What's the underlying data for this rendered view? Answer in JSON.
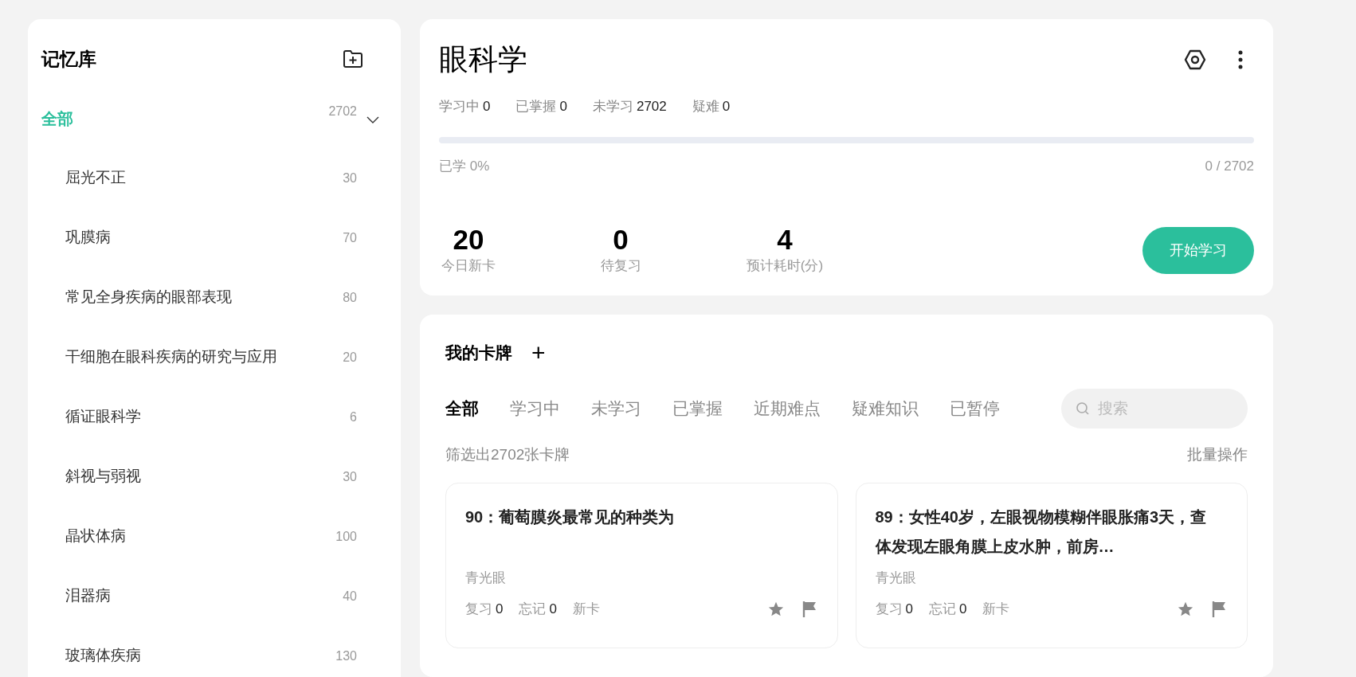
{
  "sidebar": {
    "title": "记忆库",
    "tree": {
      "label": "全部",
      "count": "2702",
      "selected": true,
      "expanded": true,
      "children": [
        {
          "label": "屈光不正",
          "count": "30",
          "selected": false
        },
        {
          "label": "巩膜病",
          "count": "70",
          "selected": false
        },
        {
          "label": "常见全身疾病的眼部表现",
          "count": "80",
          "selected": false
        },
        {
          "label": "干细胞在眼科疾病的研究与应用",
          "count": "20",
          "selected": false
        },
        {
          "label": "循证眼科学",
          "count": "6",
          "selected": false
        },
        {
          "label": "斜视与弱视",
          "count": "30",
          "selected": false
        },
        {
          "label": "晶状体病",
          "count": "100",
          "selected": false
        },
        {
          "label": "泪器病",
          "count": "40",
          "selected": false
        },
        {
          "label": "玻璃体疾病",
          "count": "130",
          "selected": false
        }
      ]
    }
  },
  "deck": {
    "title": "眼科学",
    "stats": [
      {
        "label": "学习中",
        "value": "0"
      },
      {
        "label": "已掌握",
        "value": "0"
      },
      {
        "label": "未学习",
        "value": "2702"
      },
      {
        "label": "疑难",
        "value": "0"
      }
    ],
    "progress": {
      "level": 0,
      "label": "已学 0%",
      "reading": "0 / 2702"
    },
    "metrics": [
      {
        "value": "20",
        "label": "今日新卡"
      },
      {
        "value": "0",
        "label": "待复习"
      },
      {
        "value": "4",
        "label": "预计耗时(分)"
      }
    ],
    "start_button": "开始学习"
  },
  "cards_panel": {
    "title": "我的卡牌",
    "add": "+",
    "tabs": [
      {
        "label": "全部",
        "selected": true
      },
      {
        "label": "学习中",
        "selected": false
      },
      {
        "label": "未学习",
        "selected": false
      },
      {
        "label": "已掌握",
        "selected": false
      },
      {
        "label": "近期难点",
        "selected": false
      },
      {
        "label": "疑难知识",
        "selected": false
      },
      {
        "label": "已暂停",
        "selected": false
      }
    ],
    "search": {
      "placeholder": "搜索"
    },
    "filter_text": "筛选出2702张卡牌",
    "batch": "批量操作",
    "cards": [
      {
        "title": "90：葡萄膜炎最常见的种类为",
        "tag": "青光眼",
        "review_label": "复习",
        "review": "0",
        "forget_label": "忘记",
        "forget": "0",
        "status": "新卡"
      },
      {
        "title": "89：女性40岁，左眼视物模糊伴眼胀痛3天，查体发现左眼角膜上皮水肿，前房…",
        "tag": "青光眼",
        "review_label": "复习",
        "review": "0",
        "forget_label": "忘记",
        "forget": "0",
        "status": "新卡"
      }
    ]
  }
}
